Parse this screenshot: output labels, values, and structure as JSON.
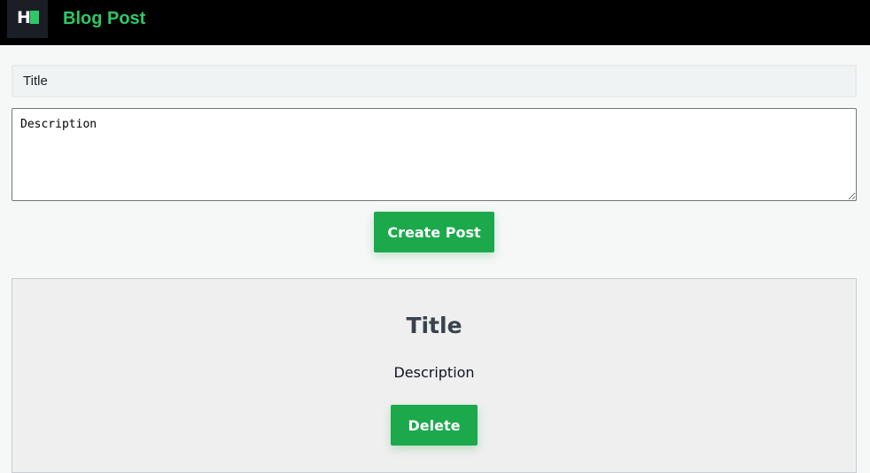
{
  "header": {
    "logo_letter": "H",
    "app_title": "Blog Post",
    "brand_color": "#2ec866"
  },
  "form": {
    "title_placeholder": "Title",
    "title_value": "",
    "description_placeholder": "Description",
    "description_value": "",
    "create_label": "Create Post",
    "button_color": "#1ba94c"
  },
  "posts": [
    {
      "title": "Title",
      "description": "Description",
      "delete_label": "Delete"
    }
  ]
}
